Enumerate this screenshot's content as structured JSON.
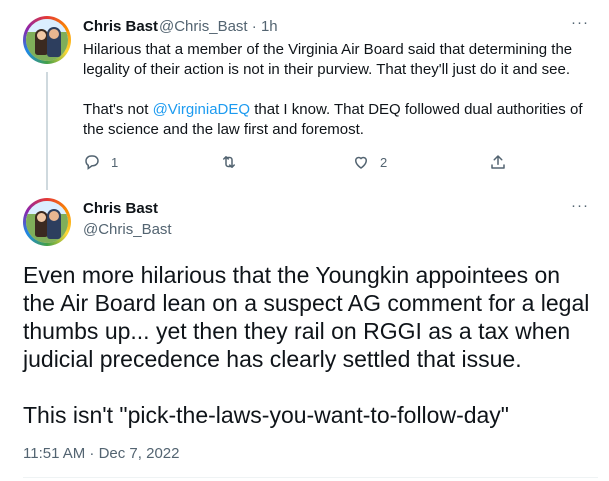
{
  "tweet1": {
    "author_name": "Chris Bast",
    "author_handle": "@Chris_Bast",
    "separator": "·",
    "age": "1h",
    "more": "···",
    "text_line1": "Hilarious that a member of the Virginia Air Board said that determining the legality of their action is not in their purview. That they'll just do it and see.",
    "text_line2_before": "That's not ",
    "mention": "@VirginiaDEQ",
    "text_line2_after": " that I know. That DEQ followed dual authorities of the science and the law first and foremost.",
    "actions": {
      "reply_icon": "reply-icon",
      "reply_count": "1",
      "retweet_icon": "retweet-icon",
      "like_icon": "heart-icon",
      "like_count": "2",
      "share_icon": "share-icon"
    }
  },
  "tweet2": {
    "author_name": "Chris Bast",
    "author_handle": "@Chris_Bast",
    "more": "···",
    "paragraph1": "Even more hilarious that the Youngkin appointees on the Air Board lean on a suspect AG comment for a legal thumbs up... yet then they rail on RGGI as a tax when judicial precedence has clearly settled that issue.",
    "paragraph2": "This isn't \"pick-the-laws-you-want-to-follow-day\"",
    "timestamp": "11:51 AM · Dec 7, 2022"
  },
  "colors": {
    "text": "#0f1419",
    "secondary": "#536471",
    "link": "#1d9bf0",
    "thread_line": "#cfd9de"
  }
}
